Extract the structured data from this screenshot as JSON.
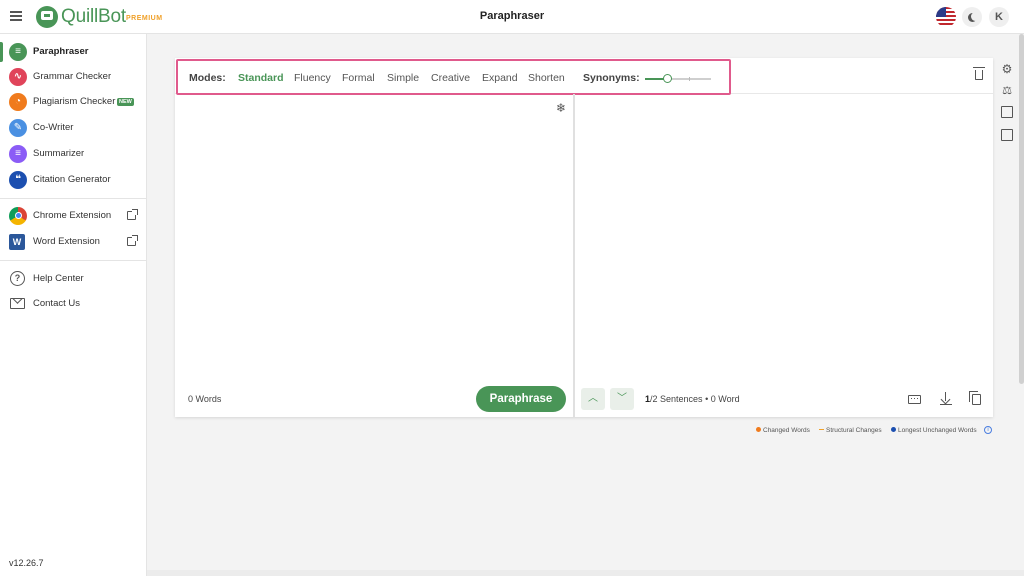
{
  "header": {
    "brand": "QuillBot",
    "premium": "PREMIUM",
    "title": "Paraphraser",
    "avatar_letter": "K"
  },
  "sidebar": {
    "items": [
      {
        "label": "Paraphraser",
        "icon": "paraphraser-icon",
        "color": "#499557"
      },
      {
        "label": "Grammar Checker",
        "icon": "grammar-icon",
        "color": "#e0445a"
      },
      {
        "label": "Plagiarism Checker",
        "icon": "plagiarism-icon",
        "color": "#f07b1d",
        "badge": "NEW"
      },
      {
        "label": "Co-Writer",
        "icon": "pen-icon",
        "color": "#4a90e2"
      },
      {
        "label": "Summarizer",
        "icon": "summarizer-icon",
        "color": "#8b5cf6"
      },
      {
        "label": "Citation Generator",
        "icon": "quote-icon",
        "color": "#1c4fb0"
      }
    ],
    "extensions": [
      {
        "label": "Chrome Extension",
        "icon": "chrome-icon"
      },
      {
        "label": "Word Extension",
        "icon": "word-icon"
      }
    ],
    "support": [
      {
        "label": "Help Center",
        "icon": "help-icon"
      },
      {
        "label": "Contact Us",
        "icon": "mail-icon"
      }
    ],
    "version": "v12.26.7"
  },
  "toolbar": {
    "modes_label": "Modes:",
    "modes": [
      "Standard",
      "Fluency",
      "Formal",
      "Simple",
      "Creative",
      "Expand",
      "Shorten"
    ],
    "active_mode": "Standard",
    "synonyms_label": "Synonyms:",
    "synonyms_level": 0.33
  },
  "input": {
    "word_count": "0 Words",
    "paraphrase_label": "Paraphrase"
  },
  "output": {
    "sentences_current": "1",
    "sentences_rest": "/2 Sentences",
    "word_count": "• 0 Word"
  },
  "legend": {
    "changed": "Changed Words",
    "structural": "Structural Changes",
    "unchanged": "Longest Unchanged Words",
    "colors": {
      "changed": "#f07b1d",
      "structural": "#f0a12a",
      "unchanged": "#1c4fb0"
    }
  },
  "colors": {
    "accent": "#499557",
    "highlight_box": "#e05a8c"
  }
}
